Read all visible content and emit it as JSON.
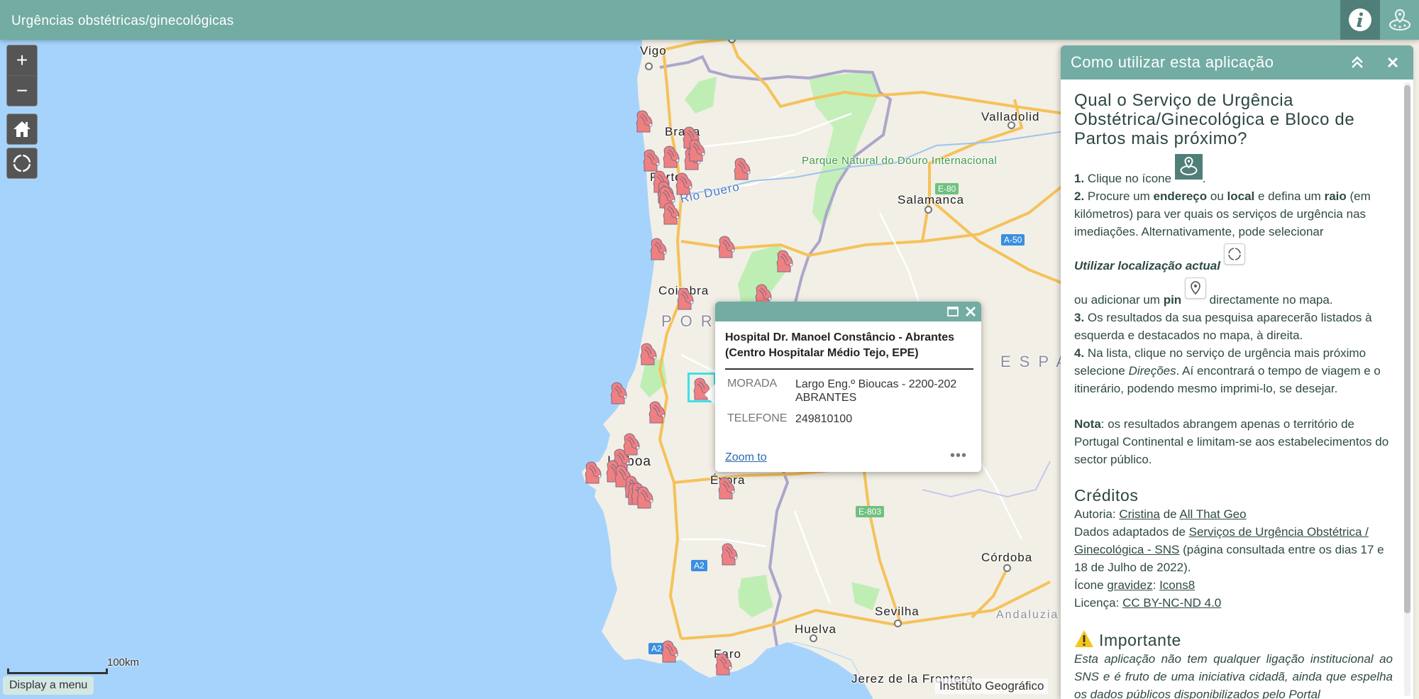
{
  "header": {
    "title": "Urgências obstétricas/ginecológicas",
    "info_icon": "info-icon",
    "nearby_icon": "nearby-search-icon"
  },
  "map_controls": {
    "zoom_in": "+",
    "zoom_out": "−",
    "home_icon": "home-icon",
    "locate_icon": "locate-crosshair-icon"
  },
  "map": {
    "labels": {
      "vigo": "Vigo",
      "braga": "Braga",
      "porto": "Porto",
      "rio_duero": "Rio Duero",
      "park": "Parque Natural do Douro Internacional",
      "valladolid": "Valladolid",
      "salamanca": "Salamanca",
      "coimbra": "Coimbra",
      "portugal": "PORTUGAL",
      "espana": "ESPAÑA",
      "lisboa": "Lisboa",
      "evora": "Évora",
      "cordoba": "Córdoba",
      "sevilha": "Sevilha",
      "huelva": "Huelva",
      "andaluzia": "Andaluzia",
      "faro": "Faro",
      "jerez": "Jerez de la Frontera"
    },
    "shields": {
      "e80": "E-80",
      "a50": "A-50",
      "e803": "E-803",
      "a2_north": "A2",
      "a2_south": "A2"
    },
    "marker_icon": "pregnancy-icon",
    "marker_color": "#f08080",
    "selected_color": "#3fe0e6",
    "scale_label": "100km",
    "attribution": "Instituto Geográfico",
    "menu_button": "Display a menu"
  },
  "popup": {
    "title": "Hospital Dr. Manoel Constâncio - Abrantes (Centro Hospitalar Médio Tejo, EPE)",
    "fields": [
      {
        "key": "MORADA",
        "value": "Largo Eng.º Bioucas - 2200-202 ABRANTES"
      },
      {
        "key": "TELEFONE",
        "value": "249810100"
      }
    ],
    "zoom_to": "Zoom to",
    "more": "•••"
  },
  "panel": {
    "title": "Como utilizar esta aplicação",
    "heading": "Qual o Serviço de Urgência Obstétrica/Ginecológica e Bloco de Partos mais próximo?",
    "step1": {
      "num": "1.",
      "text": "Clique no ícone",
      "end": "."
    },
    "step2": {
      "num": "2.",
      "t1": "Procure um",
      "b1": "endereço",
      "t2": "ou",
      "b2": "local",
      "t3": "e defina um",
      "b3": "raio",
      "t4": "(em kilómetros) para ver quais os serviços de urgência nas imediações. Alternativamente, pode selecionar",
      "i1": "Utilizar localização actual",
      "t5": "ou adicionar um",
      "b4": "pin",
      "t6": "directamente no mapa."
    },
    "step3": {
      "num": "3.",
      "text": "Os resultados da sua pesquisa aparecerão listados à esquerda e destacados no mapa, à direita."
    },
    "step4": {
      "num": "4.",
      "t1": "Na lista, clique no serviço de urgência mais próximo selecione",
      "i1": "Direções",
      "t2": ". Aí encontrará o tempo de viagem e o itinerário, podendo mesmo imprimi-lo, se desejar."
    },
    "note": {
      "label": "Nota",
      "text": ": os resultados abrangem apenas o território de Portugal Continental e limitam-se aos estabelecimentos do sector público."
    },
    "credits": {
      "heading": "Créditos",
      "author_prefix": "Autoria:",
      "author_link": "Cristina",
      "author_mid": "de",
      "org_link": "All That Geo",
      "data_prefix": "Dados adaptados de",
      "data_link": "Serviços de Urgência Obstétrica / Ginecológica - SNS",
      "data_suffix": "(página consultada entre os dias 17 e 18 de Julho de 2022).",
      "icon_prefix": "Ícone",
      "icon_link": "gravidez",
      "icon_sep": ":",
      "icon_source": "Icons8",
      "license_prefix": "Licença:",
      "license_link": "CC BY-NC-ND 4.0"
    },
    "important": {
      "heading": "Importante",
      "text": "Esta aplicação não tem qualquer ligação institucional ao SNS e é fruto de uma iniciativa cidadã, ainda que espelha os dados públicos disponibilizados pelo Portal"
    }
  }
}
